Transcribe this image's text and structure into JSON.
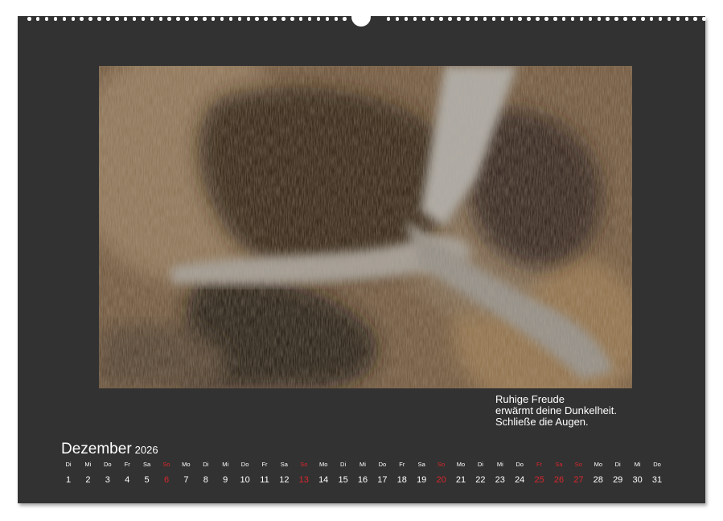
{
  "calendar": {
    "month_name": "Dezember",
    "year": "2026",
    "caption_lines": [
      "Ruhige Freude",
      "erwärmt deine Dunkelheit.",
      "Schließe die Augen."
    ],
    "days": [
      {
        "wd": "Di",
        "d": "1"
      },
      {
        "wd": "Mi",
        "d": "2"
      },
      {
        "wd": "Do",
        "d": "3"
      },
      {
        "wd": "Fr",
        "d": "4"
      },
      {
        "wd": "Sa",
        "d": "5"
      },
      {
        "wd": "So",
        "d": "6",
        "red": true
      },
      {
        "wd": "Mo",
        "d": "7"
      },
      {
        "wd": "Di",
        "d": "8"
      },
      {
        "wd": "Mi",
        "d": "9"
      },
      {
        "wd": "Do",
        "d": "10"
      },
      {
        "wd": "Fr",
        "d": "11"
      },
      {
        "wd": "Sa",
        "d": "12"
      },
      {
        "wd": "So",
        "d": "13",
        "red": true
      },
      {
        "wd": "Mo",
        "d": "14"
      },
      {
        "wd": "Di",
        "d": "15"
      },
      {
        "wd": "Mi",
        "d": "16"
      },
      {
        "wd": "Do",
        "d": "17"
      },
      {
        "wd": "Fr",
        "d": "18"
      },
      {
        "wd": "Sa",
        "d": "19"
      },
      {
        "wd": "So",
        "d": "20",
        "red": true
      },
      {
        "wd": "Mo",
        "d": "21"
      },
      {
        "wd": "Di",
        "d": "22"
      },
      {
        "wd": "Mi",
        "d": "23"
      },
      {
        "wd": "Do",
        "d": "24"
      },
      {
        "wd": "Fr",
        "d": "25",
        "red": true
      },
      {
        "wd": "Sa",
        "d": "26",
        "red": true
      },
      {
        "wd": "So",
        "d": "27",
        "red": true
      },
      {
        "wd": "Mo",
        "d": "28"
      },
      {
        "wd": "Di",
        "d": "29"
      },
      {
        "wd": "Mi",
        "d": "30"
      },
      {
        "wd": "Do",
        "d": "31"
      }
    ]
  },
  "colors": {
    "page_background": "#333232",
    "text": "#ffffff",
    "holiday_red": "#d9262c"
  }
}
